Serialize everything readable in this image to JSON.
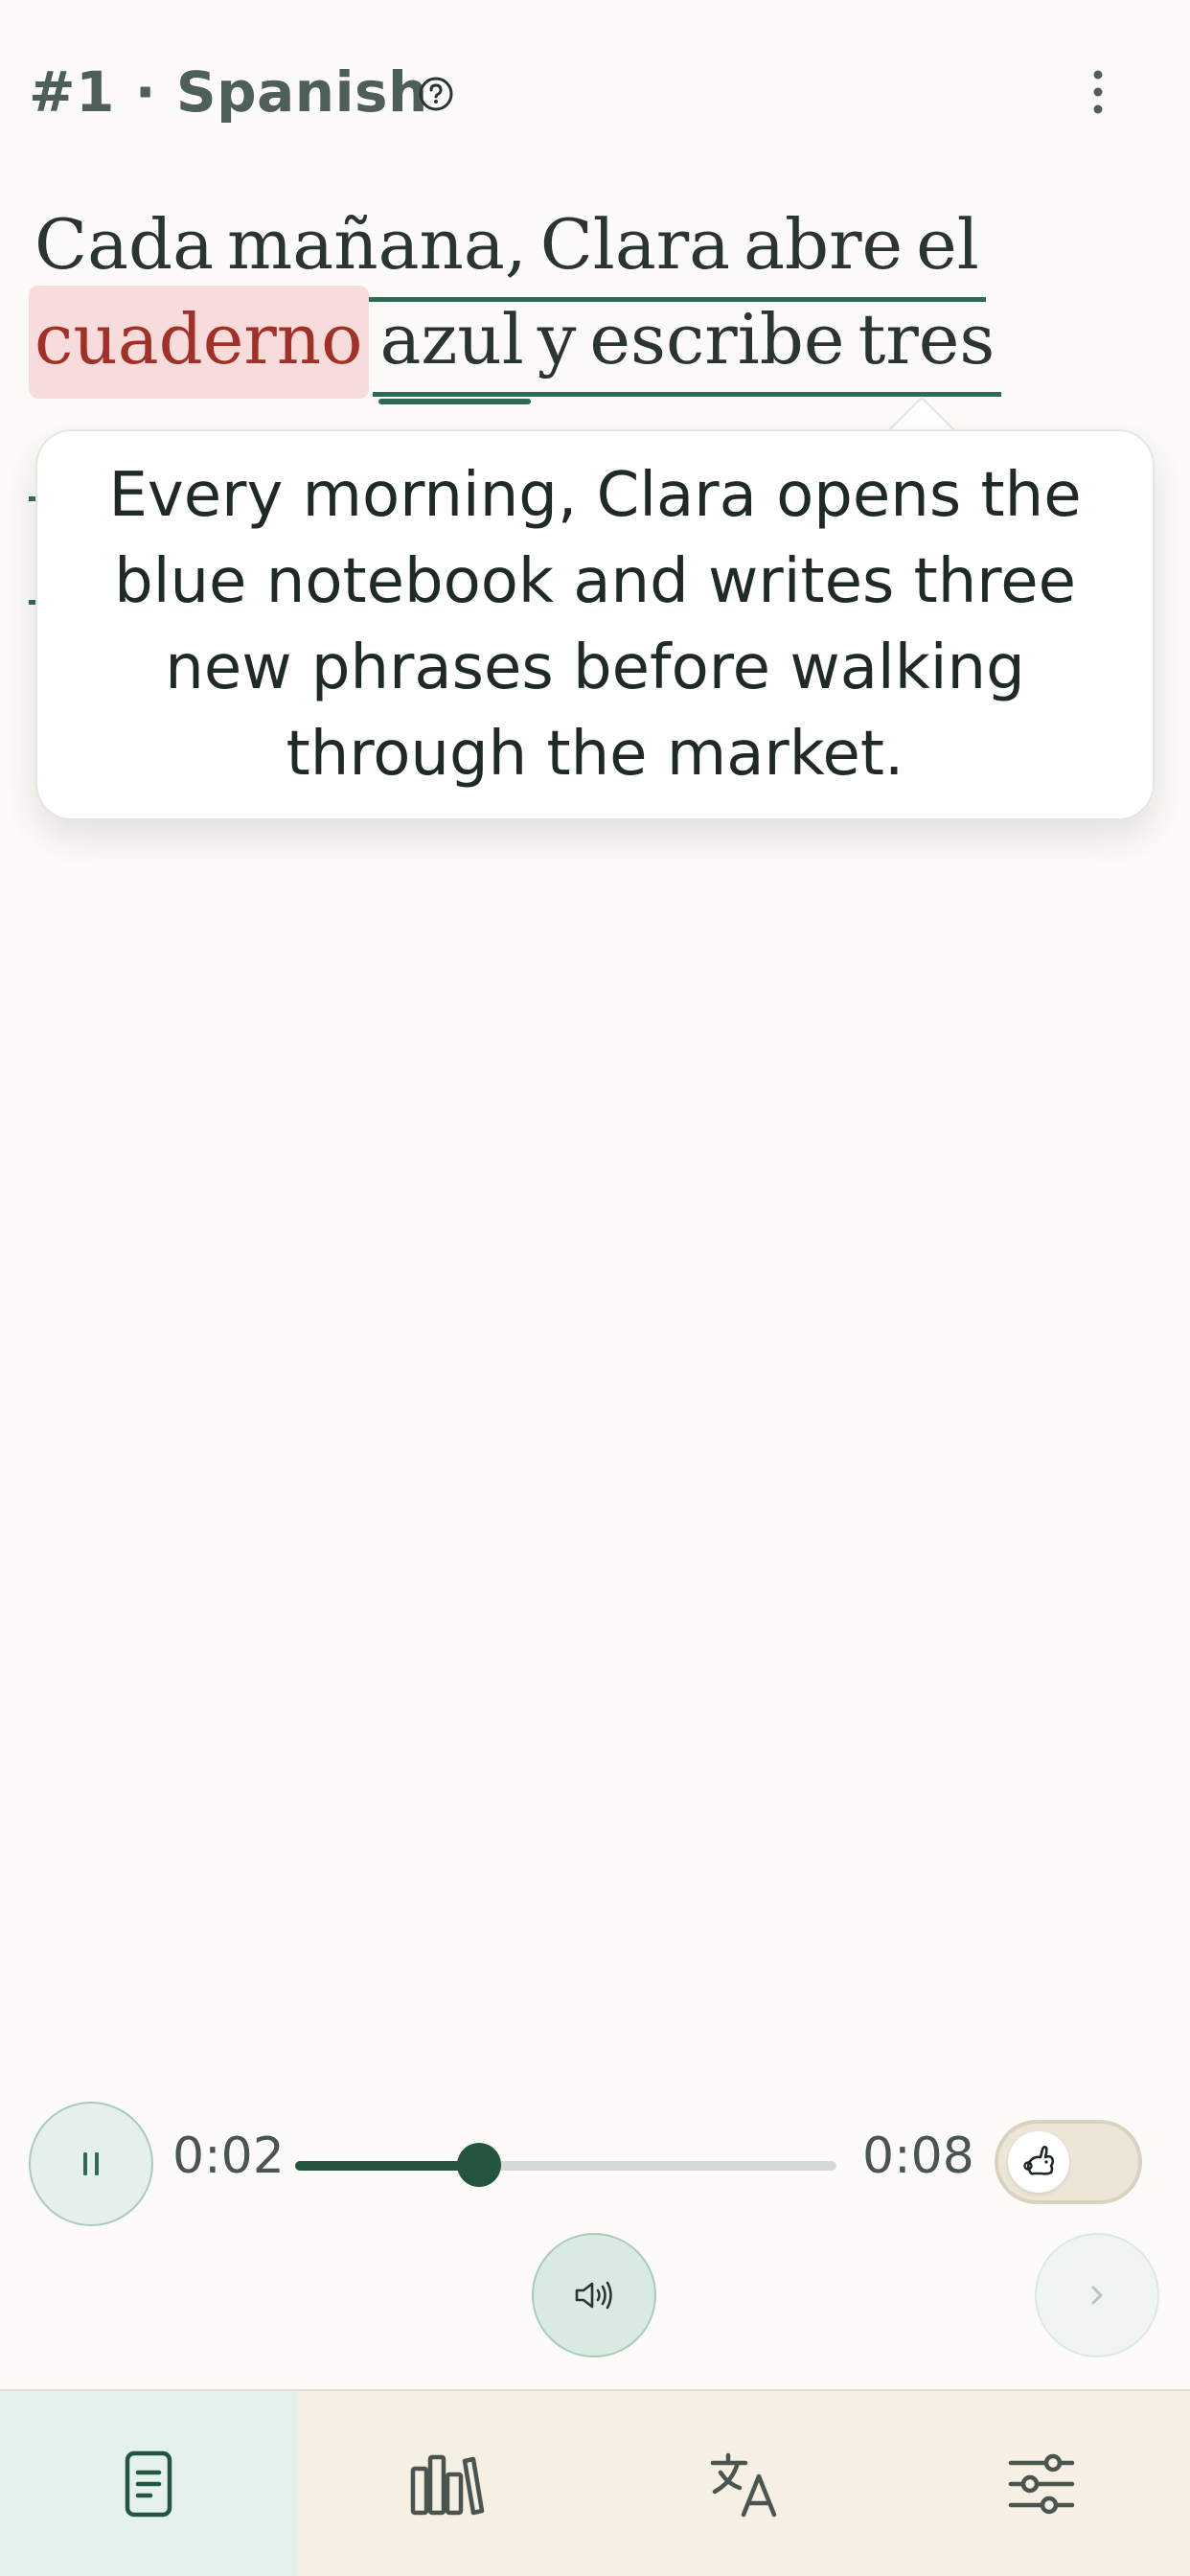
{
  "header": {
    "title": "#1 · Spanish",
    "help_icon": "question-circle-icon",
    "menu_icon": "more-vertical-icon"
  },
  "reading": {
    "line1": [
      "Cada",
      "mañana,",
      "Clara",
      "abre",
      "el"
    ],
    "line2": [
      "cuaderno",
      "azul",
      "y",
      "escribe",
      "tres"
    ],
    "highlighted_word": "cuaderno"
  },
  "tooltip": {
    "translation": "Every morning, Clara opens the blue notebook and writes three new phrases before walking through the market."
  },
  "player": {
    "current_time": "0:02",
    "duration": "0:08",
    "progress_fraction": 0.34,
    "slow_toggle_icon": "rabbit-icon",
    "slow_toggle_on": false,
    "play_icon": "pause-icon",
    "speak_icon": "speaker-icon",
    "next_icon": "chevron-right-icon"
  },
  "bottom_nav": {
    "items": [
      {
        "icon": "document-icon",
        "active": true
      },
      {
        "icon": "library-icon",
        "active": false
      },
      {
        "icon": "translate-icon",
        "active": false
      },
      {
        "icon": "settings-sliders-icon",
        "active": false
      }
    ]
  },
  "colors": {
    "accent": "#2d6b52",
    "highlight_bg": "#f8dcdc",
    "highlight_text": "#a23026",
    "background": "#fdfbf8",
    "nav_background": "#f6efe4"
  }
}
